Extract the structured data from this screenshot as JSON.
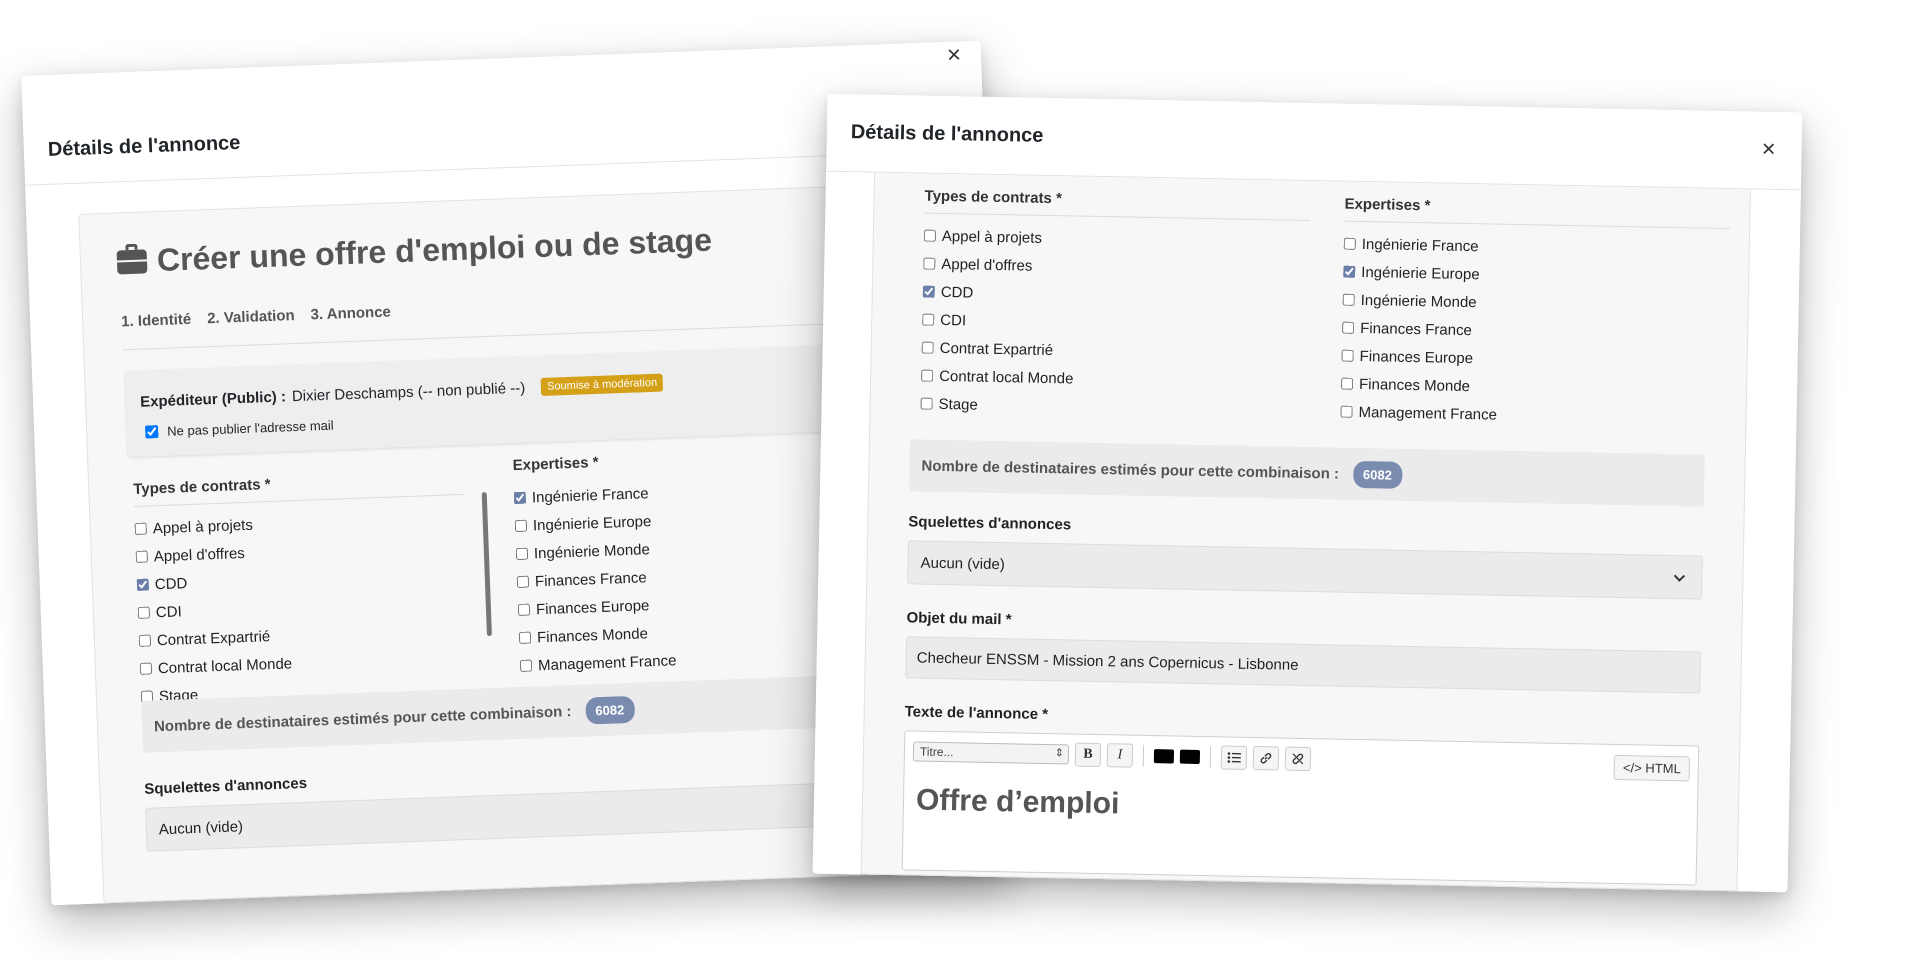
{
  "modal_back": {
    "title": "Détails de l'annonce",
    "close": "×",
    "heading": "Créer une offre d'emploi ou de stage",
    "steps": [
      "1. Identité",
      "2. Validation",
      "3. Annonce"
    ],
    "sender_label": "Expéditeur (Public) :",
    "sender_value": "Dixier Deschamps (-- non publié --)",
    "moderation_badge": "Soumise à modération",
    "hide_email_label": "Ne pas publier l'adresse mail",
    "contracts_title": "Types de contrats *",
    "contracts": [
      {
        "label": "Appel à projets",
        "checked": false
      },
      {
        "label": "Appel d'offres",
        "checked": false
      },
      {
        "label": "CDD",
        "checked": true
      },
      {
        "label": "CDI",
        "checked": false
      },
      {
        "label": "Contrat Expartrié",
        "checked": false
      },
      {
        "label": "Contrat local Monde",
        "checked": false
      },
      {
        "label": "Stage",
        "checked": false
      }
    ],
    "expertises_title": "Expertises *",
    "expertises": [
      {
        "label": "Ingénierie France",
        "checked": true
      },
      {
        "label": "Ingénierie Europe",
        "checked": false
      },
      {
        "label": "Ingénierie Monde",
        "checked": false
      },
      {
        "label": "Finances France",
        "checked": false
      },
      {
        "label": "Finances Europe",
        "checked": false
      },
      {
        "label": "Finances Monde",
        "checked": false
      },
      {
        "label": "Management France",
        "checked": false
      }
    ],
    "estimate_label": "Nombre de destinataires estimés pour cette combinaison :",
    "estimate_count": "6082",
    "skeletons_label": "Squelettes d'annonces",
    "skeletons_value": "Aucun (vide)"
  },
  "modal_front": {
    "title": "Détails de l'annonce",
    "close": "×",
    "contracts_title": "Types de contrats *",
    "contracts": [
      {
        "label": "Appel à projets",
        "checked": false
      },
      {
        "label": "Appel d'offres",
        "checked": false
      },
      {
        "label": "CDD",
        "checked": true
      },
      {
        "label": "CDI",
        "checked": false
      },
      {
        "label": "Contrat Expartrié",
        "checked": false
      },
      {
        "label": "Contrat local Monde",
        "checked": false
      },
      {
        "label": "Stage",
        "checked": false
      }
    ],
    "expertises_title": "Expertises *",
    "expertises": [
      {
        "label": "Ingénierie France",
        "checked": false
      },
      {
        "label": "Ingénierie Europe",
        "checked": true
      },
      {
        "label": "Ingénierie Monde",
        "checked": false
      },
      {
        "label": "Finances France",
        "checked": false
      },
      {
        "label": "Finances Europe",
        "checked": false
      },
      {
        "label": "Finances Monde",
        "checked": false
      },
      {
        "label": "Management France",
        "checked": false
      }
    ],
    "estimate_label": "Nombre de destinataires estimés pour cette combinaison :",
    "estimate_count": "6082",
    "skeletons_label": "Squelettes d'annonces",
    "skeletons_value": "Aucun (vide)",
    "subject_label": "Objet du mail *",
    "subject_value": "Checheur ENSSM - Mission 2 ans Copernicus - Lisbonne",
    "text_label": "Texte de l'annonce *",
    "editor": {
      "format_select": "Titre...",
      "bold": "B",
      "italic": "I",
      "html_button": "</> HTML",
      "content_heading": "Offre d’emploi"
    }
  }
}
